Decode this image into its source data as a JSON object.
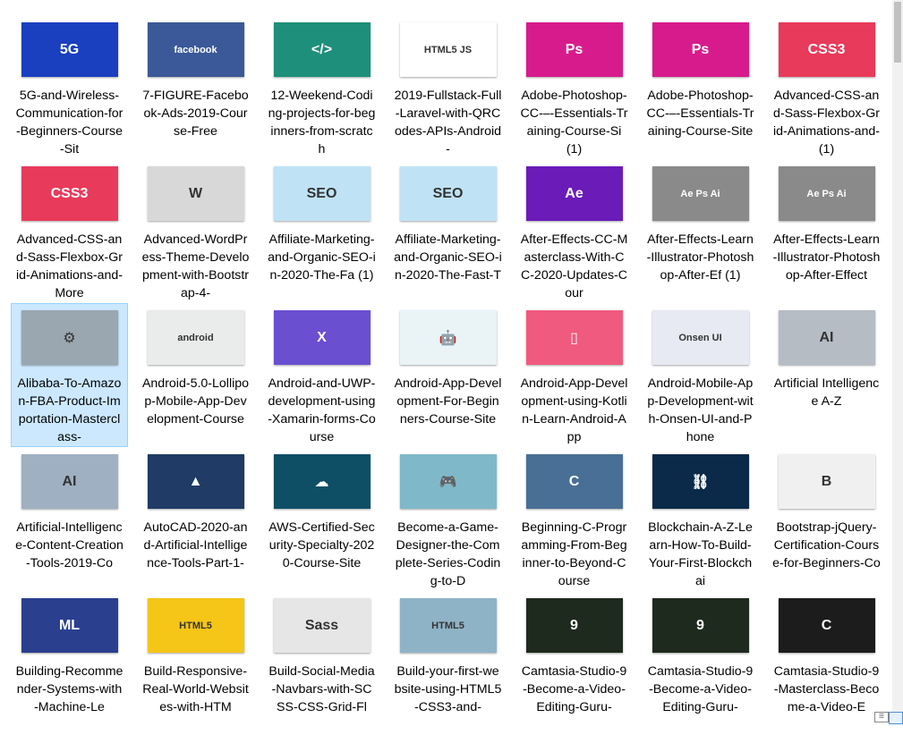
{
  "files": [
    {
      "name": "5G-and-Wireless-Communication-for-Beginners-Course-Sit",
      "icon": "5g-network-thumbnail-icon",
      "bg": "#1a3fbf",
      "glyph": "5G"
    },
    {
      "name": "7-FIGURE-Facebook-Ads-2019-Course-Free",
      "icon": "facebook-logo-thumbnail-icon",
      "bg": "#3b5998",
      "glyph": "facebook"
    },
    {
      "name": "12-Weekend-Coding-projects-for-beginners-from-scratch",
      "icon": "code-editor-thumbnail-icon",
      "bg": "#1d8f7a",
      "glyph": "</>"
    },
    {
      "name": "2019-Fullstack-Full-Laravel-with-QRCodes-APIs-Android-",
      "icon": "web-tech-logos-thumbnail-icon",
      "bg": "#ffffff",
      "glyph": "HTML5 JS"
    },
    {
      "name": "Adobe-Photoshop-CC-–-Essentials-Training-Course-Si (1)",
      "icon": "photoshop-instructor-thumbnail-icon",
      "bg": "#d81b8c",
      "glyph": "Ps"
    },
    {
      "name": "Adobe-Photoshop-CC-–-Essentials-Training-Course-Site",
      "icon": "photoshop-instructor-thumbnail-icon",
      "bg": "#d81b8c",
      "glyph": "Ps"
    },
    {
      "name": "Advanced-CSS-and-Sass-Flexbox-Grid-Animations-and- (1)",
      "icon": "css3-laptop-thumbnail-icon",
      "bg": "#e83a5a",
      "glyph": "CSS3"
    },
    {
      "name": "Advanced-CSS-and-Sass-Flexbox-Grid-Animations-and-More",
      "icon": "css3-laptop-thumbnail-icon",
      "bg": "#e83a5a",
      "glyph": "CSS3"
    },
    {
      "name": "Advanced-WordPress-Theme-Development-with-Bootstrap-4-",
      "icon": "wordpress-instructor-thumbnail-icon",
      "bg": "#d8d8d8",
      "glyph": "W"
    },
    {
      "name": "Affiliate-Marketing-and-Organic-SEO-in-2020-The-Fa (1)",
      "icon": "marketing-illustration-thumbnail-icon",
      "bg": "#bfe3f5",
      "glyph": "SEO"
    },
    {
      "name": "Affiliate-Marketing-and-Organic-SEO-in-2020-The-Fast-T",
      "icon": "marketing-illustration-thumbnail-icon",
      "bg": "#bfe3f5",
      "glyph": "SEO"
    },
    {
      "name": "After-Effects-CC-Masterclass-With-CC-2020-Updates-Cour",
      "icon": "after-effects-instructor-thumbnail-icon",
      "bg": "#6a1bb8",
      "glyph": "Ae"
    },
    {
      "name": "After-Effects-Learn-Illustrator-Photoshop-After-Ef (1)",
      "icon": "adobe-apps-thumbnail-icon",
      "bg": "#8a8a8a",
      "glyph": "Ae Ps Ai"
    },
    {
      "name": "After-Effects-Learn-Illustrator-Photoshop-After-Effect",
      "icon": "adobe-apps-thumbnail-icon",
      "bg": "#8a8a8a",
      "glyph": "Ae Ps Ai"
    },
    {
      "name": "Alibaba-To-Amazon-FBA-Product-Importation-Masterclass-",
      "icon": "laptop-gears-thumbnail-icon",
      "bg": "#9aa7b0",
      "glyph": "⚙"
    },
    {
      "name": "Android-5.0-Lollipop-Mobile-App-Development-Course",
      "icon": "android-phone-thumbnail-icon",
      "bg": "#e9ecea",
      "glyph": "android"
    },
    {
      "name": "Android-and-UWP-development-using-Xamarin-forms-Course",
      "icon": "xamarin-thumbnail-icon",
      "bg": "#6a4fd1",
      "glyph": "X"
    },
    {
      "name": "Android-App-Development-For-Beginners-Course-Site",
      "icon": "android-robot-thumbnail-icon",
      "bg": "#eaf3f6",
      "glyph": "🤖"
    },
    {
      "name": "Android-App-Development-using-Kotlin-Learn-Android-App",
      "icon": "kotlin-phone-thumbnail-icon",
      "bg": "#f05a7e",
      "glyph": "▯"
    },
    {
      "name": "Android-Mobile-App-Development-with-Onsen-UI-and-Phone",
      "icon": "onsen-ui-thumbnail-icon",
      "bg": "#e7eaf2",
      "glyph": "Onsen UI"
    },
    {
      "name": "Artificial Intelligence A-Z",
      "icon": "ai-robot-thumbnail-icon",
      "bg": "#b5bcc4",
      "glyph": "AI"
    },
    {
      "name": "Artificial-Intelligence-Content-Creation-Tools-2019-Co",
      "icon": "ai-robot-office-thumbnail-icon",
      "bg": "#9fb0c2",
      "glyph": "AI"
    },
    {
      "name": "AutoCAD-2020-and-Artificial-Intelligence-Tools-Part-1-",
      "icon": "skyscraper-thumbnail-icon",
      "bg": "#1f3b66",
      "glyph": "▲"
    },
    {
      "name": "AWS-Certified-Security-Specialty-2020-Course-Site",
      "icon": "cloud-lock-thumbnail-icon",
      "bg": "#0e4f66",
      "glyph": "☁"
    },
    {
      "name": "Become-a-Game-Designer-the-Complete-Series-Coding-to-D",
      "icon": "gamepad-thumbnail-icon",
      "bg": "#7fb8c9",
      "glyph": "🎮"
    },
    {
      "name": "Beginning-C-Programming-From-Beginner-to-Beyond-Course",
      "icon": "c-language-laptop-thumbnail-icon",
      "bg": "#4a6f96",
      "glyph": "C"
    },
    {
      "name": "Blockchain-A-Z-Learn-How-To-Build-Your-First-Blockchai",
      "icon": "blockchain-network-thumbnail-icon",
      "bg": "#0b2a4a",
      "glyph": "⛓"
    },
    {
      "name": "Bootstrap-jQuery-Certification-Course-for-Beginners-Co",
      "icon": "bootstrap-logo-thumbnail-icon",
      "bg": "#f0f0f0",
      "glyph": "B"
    },
    {
      "name": "Building-Recommender-Systems-with-Machine-Le",
      "icon": "instructor-network-thumbnail-icon",
      "bg": "#2b3f8f",
      "glyph": "ML"
    },
    {
      "name": "Build-Responsive-Real-World-Websites-with-HTM",
      "icon": "html5-css3-laptop-thumbnail-icon",
      "bg": "#f5c518",
      "glyph": "HTML5"
    },
    {
      "name": "Build-Social-Media-Navbars-with-SCSS-CSS-Grid-Fl",
      "icon": "sass-logo-thumbnail-icon",
      "bg": "#e6e6e6",
      "glyph": "Sass"
    },
    {
      "name": "Build-your-first-website-using-HTML5-CSS3-and-",
      "icon": "website-wireframe-thumbnail-icon",
      "bg": "#8fb3c6",
      "glyph": "HTML5"
    },
    {
      "name": "Camtasia-Studio-9-Become-a-Video-Editing-Guru-",
      "icon": "camtasia-instructor-thumbnail-icon",
      "bg": "#1e2a1e",
      "glyph": "9"
    },
    {
      "name": "Camtasia-Studio-9-Become-a-Video-Editing-Guru-",
      "icon": "camtasia-instructor-thumbnail-icon",
      "bg": "#1e2a1e",
      "glyph": "9"
    },
    {
      "name": "Camtasia-Studio-9-Masterclass-Become-a-Video-E",
      "icon": "camtasia-logo-thumbnail-icon",
      "bg": "#1c1c1c",
      "glyph": "C"
    }
  ],
  "selected_index": 14
}
